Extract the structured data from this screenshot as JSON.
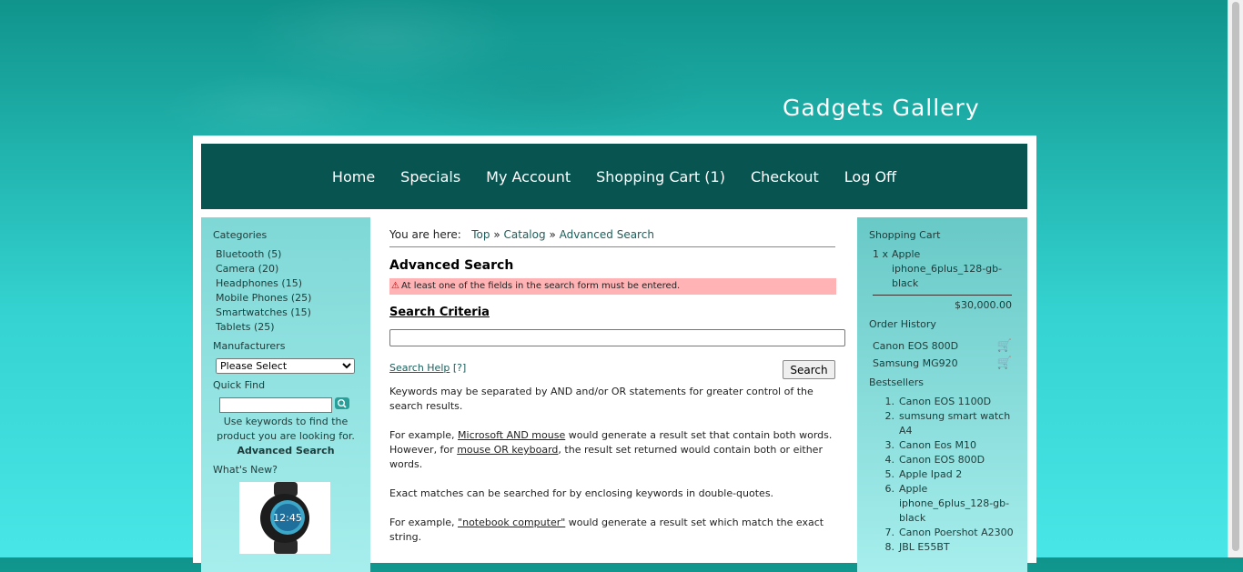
{
  "header": {
    "site_title": "Gadgets Gallery"
  },
  "nav": [
    "Home",
    "Specials",
    "My Account",
    "Shopping Cart (1)",
    "Checkout",
    "Log Off"
  ],
  "left": {
    "categories_title": "Categories",
    "categories": [
      "Bluetooth (5)",
      "Camera (20)",
      "Headphones (15)",
      "Mobile Phones (25)",
      "Smartwatches (15)",
      "Tablets (25)"
    ],
    "manufacturers_title": "Manufacturers",
    "manufacturer_selected": "Please Select",
    "quickfind_title": "Quick Find",
    "quickfind_help": "Use keywords to find the product you are looking for.",
    "advanced_search": "Advanced Search",
    "whats_new_title": "What's New?",
    "whats_new_image_text": "12:45"
  },
  "main": {
    "breadcrumb_label": "You are here:",
    "breadcrumb": [
      "Top",
      "Catalog",
      "Advanced Search"
    ],
    "breadcrumb_sep": "»",
    "heading": "Advanced Search",
    "error": "At least one of the fields in the search form must be entered.",
    "criteria_title": "Search Criteria",
    "keywords_value": "",
    "search_help": "Search Help",
    "search_help_q": "[?]",
    "search_button": "Search",
    "p1": "Keywords may be separated by AND and/or OR statements for greater control of the search results.",
    "p2_pre": "For example, ",
    "p2_link1": "Microsoft AND mouse",
    "p2_mid": " would generate a result set that contain both words. However, for ",
    "p2_link2": "mouse OR keyboard",
    "p2_post": ", the result set returned would contain both or either words.",
    "p3": "Exact matches can be searched for by enclosing keywords in double-quotes.",
    "p4_pre": "For example, ",
    "p4_link": "\"notebook computer\"",
    "p4_post": " would generate a result set which match the exact string."
  },
  "right": {
    "cart_title": "Shopping Cart",
    "cart_qty": "1 x",
    "cart_item": "Apple iphone_6plus_128-gb-black",
    "cart_total": "$30,000.00",
    "order_history_title": "Order History",
    "order_history": [
      "Canon EOS 800D",
      "Samsung MG920"
    ],
    "bestsellers_title": "Bestsellers",
    "bestsellers": [
      "Canon EOS 1100D",
      "sumsung smart watch A4",
      "Canon Eos M10",
      "Canon EOS 800D",
      "Apple Ipad 2",
      "Apple iphone_6plus_128-gb-black",
      "Canon Poershot A2300",
      "JBL E55BT"
    ]
  },
  "colors": {
    "nav_bg": "#075450",
    "error_bg": "#ffb3b5",
    "link": "#1b5e5b"
  }
}
